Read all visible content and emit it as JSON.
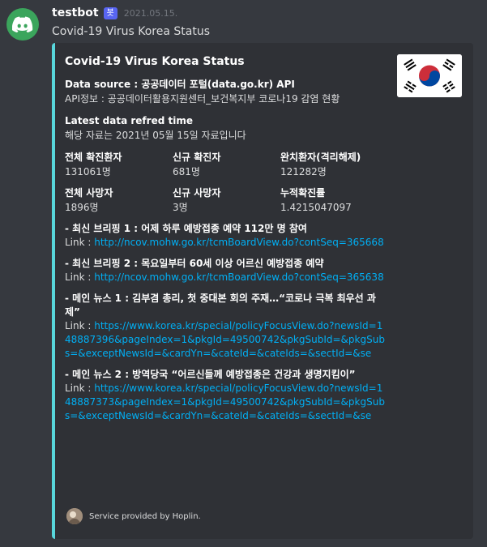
{
  "message": {
    "username": "testbot",
    "bot_tag": "봇",
    "timestamp": "2021.05.15.",
    "content": "Covid-19 Virus Korea Status"
  },
  "embed": {
    "title": "Covid-19 Virus Korea Status",
    "accent_color": "#58d6db",
    "thumbnail": "south-korea-flag",
    "source": {
      "name": "Data source : 공공데이터 포털(data.go.kr) API",
      "value": "API정보 : 공공데이터활용지원센터_보건복지부 코로나19 감염 현황"
    },
    "latest": {
      "name": "Latest data refred time",
      "value": "해당 자료는 2021년 05월 15일 자료입니다"
    },
    "stats": [
      {
        "name": "전체 확진환자",
        "value": "131061명"
      },
      {
        "name": "신규 확진자",
        "value": "681명"
      },
      {
        "name": "완치환자(격리해제)",
        "value": "121282명"
      },
      {
        "name": "전체 사망자",
        "value": "1896명"
      },
      {
        "name": "신규 사망자",
        "value": "3명"
      },
      {
        "name": "누적확진률",
        "value": "1.4215047097"
      }
    ],
    "news": [
      {
        "title": "- 최신 브리핑 1 : 어제 하루 예방접종 예약 112만 명 참여",
        "link_label": "Link : ",
        "url": "http://ncov.mohw.go.kr/tcmBoardView.do?contSeq=365668"
      },
      {
        "title": "- 최신 브리핑 2 : 목요일부터 60세 이상 어르신 예방접종 예약",
        "link_label": "Link : ",
        "url": "http://ncov.mohw.go.kr/tcmBoardView.do?contSeq=365638"
      },
      {
        "title": "- 메인 뉴스 1 : 김부겸 총리, 첫 중대본 회의 주재…“코로나 극복 최우선 과제”",
        "link_label": "Link : ",
        "url": "https://www.korea.kr/special/policyFocusView.do?newsId=148887396&pageIndex=1&pkgId=49500742&pkgSubId=&pkgSubs=&exceptNewsId=&cardYn=&cateId=&cateIds=&sectId=&se"
      },
      {
        "title": "- 메인 뉴스 2 : 방역당국 “어르신들께 예방접종은 건강과 생명지킴이”",
        "link_label": "Link : ",
        "url": "https://www.korea.kr/special/policyFocusView.do?newsId=148887373&pageIndex=1&pkgId=49500742&pkgSubId=&pkgSubs=&exceptNewsId=&cardYn=&cateId=&cateIds=&sectId=&se"
      }
    ],
    "footer": "Service provided by Hoplin."
  }
}
